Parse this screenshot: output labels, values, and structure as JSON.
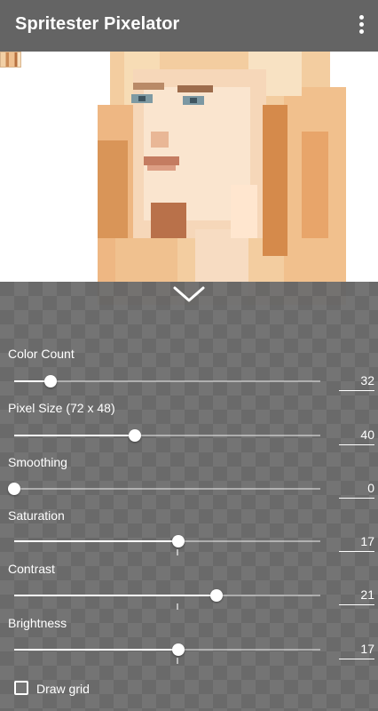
{
  "app": {
    "title": "Spritester Pixelator"
  },
  "controls": [
    {
      "label": "Color Count",
      "value": "32",
      "fraction": 0.12,
      "center_mark": false
    },
    {
      "label": "Pixel Size (72 x 48)",
      "value": "40",
      "fraction": 0.395,
      "center_mark": false
    },
    {
      "label": "Smoothing",
      "value": "0",
      "fraction": 0.0,
      "center_mark": false
    },
    {
      "label": "Saturation",
      "value": "17",
      "fraction": 0.535,
      "center_mark": true
    },
    {
      "label": "Contrast",
      "value": "21",
      "fraction": 0.66,
      "center_mark": true
    },
    {
      "label": "Brightness",
      "value": "17",
      "fraction": 0.535,
      "center_mark": true
    }
  ],
  "draw_grid": {
    "label": "Draw grid",
    "checked": false
  }
}
